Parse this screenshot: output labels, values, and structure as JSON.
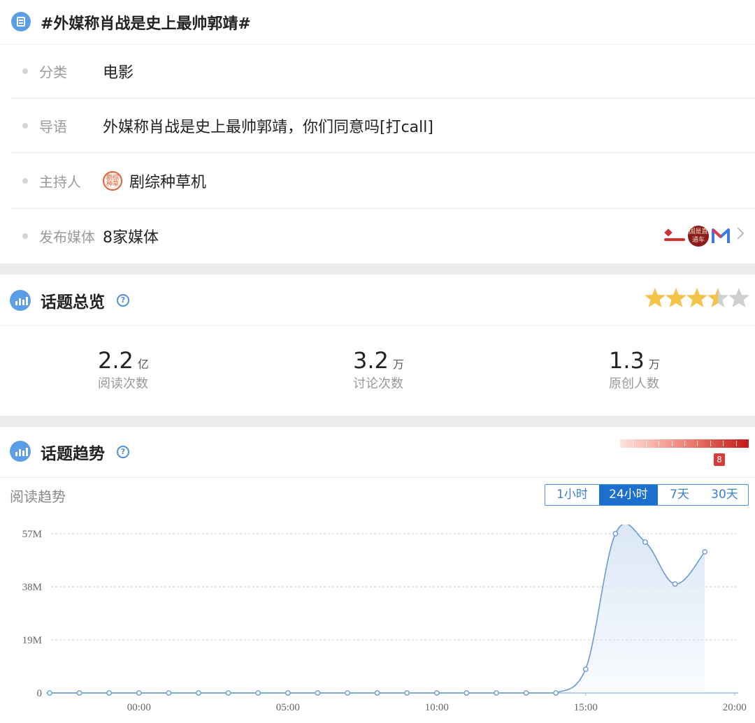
{
  "topic": {
    "title": "#外媒称肖战是史上最帅郭靖#",
    "icon": "document-list-icon"
  },
  "info": {
    "category_label": "分类",
    "category_value": "电影",
    "intro_label": "导语",
    "intro_value": "外媒称肖战是史上最帅郭靖，你们同意吗[打call]",
    "host_label": "主持人",
    "host_value": "剧综种草机",
    "host_avatar_text": "剧综种草",
    "media_label": "发布媒体",
    "media_value": "8家媒体",
    "media_logo_b_text": "国是直通车"
  },
  "overview": {
    "title": "话题总览",
    "rating": 3.5,
    "max_rating": 5,
    "star_color": "#f4c34a",
    "star_empty_color": "#d0d0d0",
    "stats": [
      {
        "num": "2.2",
        "unit": "亿",
        "desc": "阅读次数"
      },
      {
        "num": "3.2",
        "unit": "万",
        "desc": "讨论次数"
      },
      {
        "num": "1.3",
        "unit": "万",
        "desc": "原创人数"
      }
    ]
  },
  "trend": {
    "title": "话题趋势",
    "heat_level": "8",
    "subtitle": "阅读趋势",
    "ranges": [
      "1小时",
      "24小时",
      "7天",
      "30天"
    ],
    "active_range": "24小时",
    "accent": "#1d6fce"
  },
  "chart_data": {
    "type": "area",
    "ylabels": [
      "57M",
      "38M",
      "19M",
      "0"
    ],
    "yticks": [
      57,
      38,
      19,
      0
    ],
    "ylim": [
      0,
      57
    ],
    "xtick_labels": [
      "00:00",
      "05:00",
      "10:00",
      "15:00",
      "20:00"
    ],
    "xtick_hours": [
      1,
      6,
      11,
      16,
      21
    ],
    "x": [
      -2,
      -1,
      0,
      1,
      2,
      3,
      4,
      5,
      6,
      7,
      8,
      9,
      10,
      11,
      12,
      13,
      14,
      15,
      16,
      17,
      18,
      19,
      20
    ],
    "values": [
      0,
      0,
      0,
      0,
      0,
      0,
      0,
      0,
      0,
      0,
      0,
      0,
      0,
      0,
      0,
      0,
      0,
      0,
      8.5,
      57,
      54,
      39,
      50.5
    ],
    "line_color": "#6a9ad6",
    "fill_color": "#dbe7f6",
    "grid": true
  }
}
